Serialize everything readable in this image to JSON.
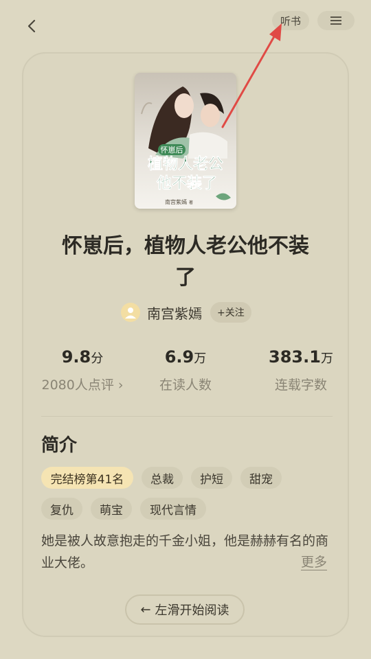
{
  "header": {
    "listen_label": "听书"
  },
  "book": {
    "title_line1": "怀崽后，植物人老公他不装",
    "title_line2": "了",
    "cover": {
      "tag_text": "怀崽后",
      "title_line1": "植物人老公",
      "title_line2": "他不装了",
      "author_mark": "南宫紫嫣",
      "author_mark_suffix": "著"
    }
  },
  "author": {
    "name": "南宫紫嫣",
    "follow_label": "+关注"
  },
  "stats": [
    {
      "value": "9.8",
      "unit": "分",
      "label": "2080人点评 ›"
    },
    {
      "value": "6.9",
      "unit": "万",
      "label": "在读人数"
    },
    {
      "value": "383.1",
      "unit": "万",
      "label": "连载字数"
    }
  ],
  "intro": {
    "heading": "简介",
    "tags": [
      "完结榜第41名",
      "总裁",
      "护短",
      "甜宠",
      "复仇",
      "萌宝",
      "现代言情"
    ],
    "summary": "她是被人故意抱走的千金小姐，他是赫赫有名的商业大佬。",
    "more_label": "更多"
  },
  "read_button": {
    "arrow": "←",
    "label": "左滑开始阅读"
  },
  "colors": {
    "background": "#ddd8c2",
    "accent_tag": "#f5e4b3",
    "annotation": "#e04a45"
  }
}
